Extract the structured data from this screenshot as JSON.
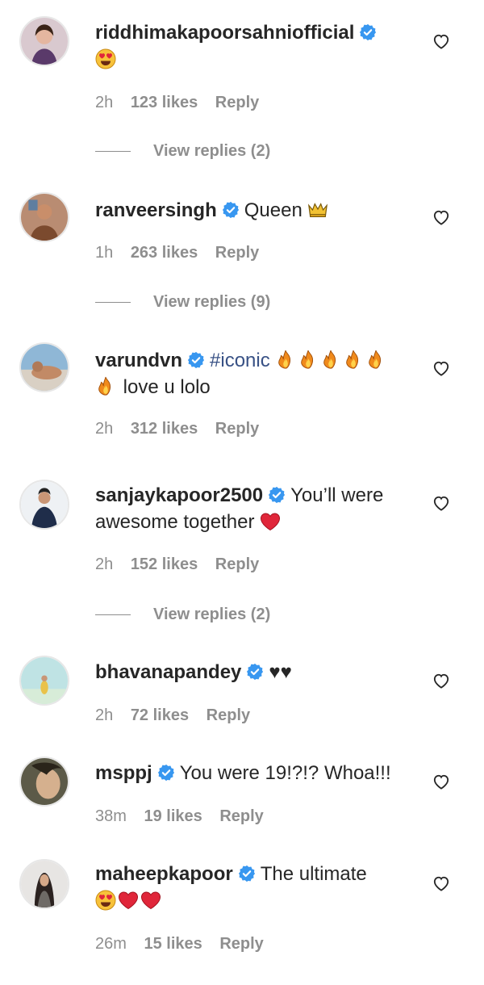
{
  "colors": {
    "verified": "#3897f0",
    "meta": "#8e8e8e",
    "hashtag": "#385185",
    "text": "#262626"
  },
  "comments": [
    {
      "username": "riddhimakapoorsahniofficial",
      "text": "",
      "emoji_line": "heart-eyes-emoji",
      "time": "2h",
      "likes": "123 likes",
      "reply": "Reply",
      "view_replies": "View replies (2)"
    },
    {
      "username": "ranveersingh",
      "text": "Queen",
      "emojis_inline": [
        "crown-emoji"
      ],
      "time": "1h",
      "likes": "263 likes",
      "reply": "Reply",
      "view_replies": "View replies (9)"
    },
    {
      "username": "varundvn",
      "hashtag": "#iconic",
      "text2": "love u lolo",
      "emojis_inline": [
        "fire-emoji",
        "fire-emoji",
        "fire-emoji",
        "fire-emoji",
        "fire-emoji",
        "fire-emoji"
      ],
      "time": "2h",
      "likes": "312 likes",
      "reply": "Reply"
    },
    {
      "username": "sanjaykapoor2500",
      "text": "You’ll were",
      "text2": "awesome together",
      "emojis_inline": [
        "red-heart-emoji"
      ],
      "time": "2h",
      "likes": "152 likes",
      "reply": "Reply",
      "view_replies": "View replies (2)"
    },
    {
      "username": "bhavanapandey",
      "text": "♥♥",
      "time": "2h",
      "likes": "72 likes",
      "reply": "Reply"
    },
    {
      "username": "msppj",
      "text": "You were 19!?!? Whoa!!!",
      "time": "38m",
      "likes": "19 likes",
      "reply": "Reply"
    },
    {
      "username": "maheepkapoor",
      "text": "The ultimate",
      "emojis_inline": [
        "heart-eyes-emoji",
        "red-heart-emoji",
        "red-heart-emoji"
      ],
      "time": "26m",
      "likes": "15 likes",
      "reply": "Reply"
    }
  ]
}
